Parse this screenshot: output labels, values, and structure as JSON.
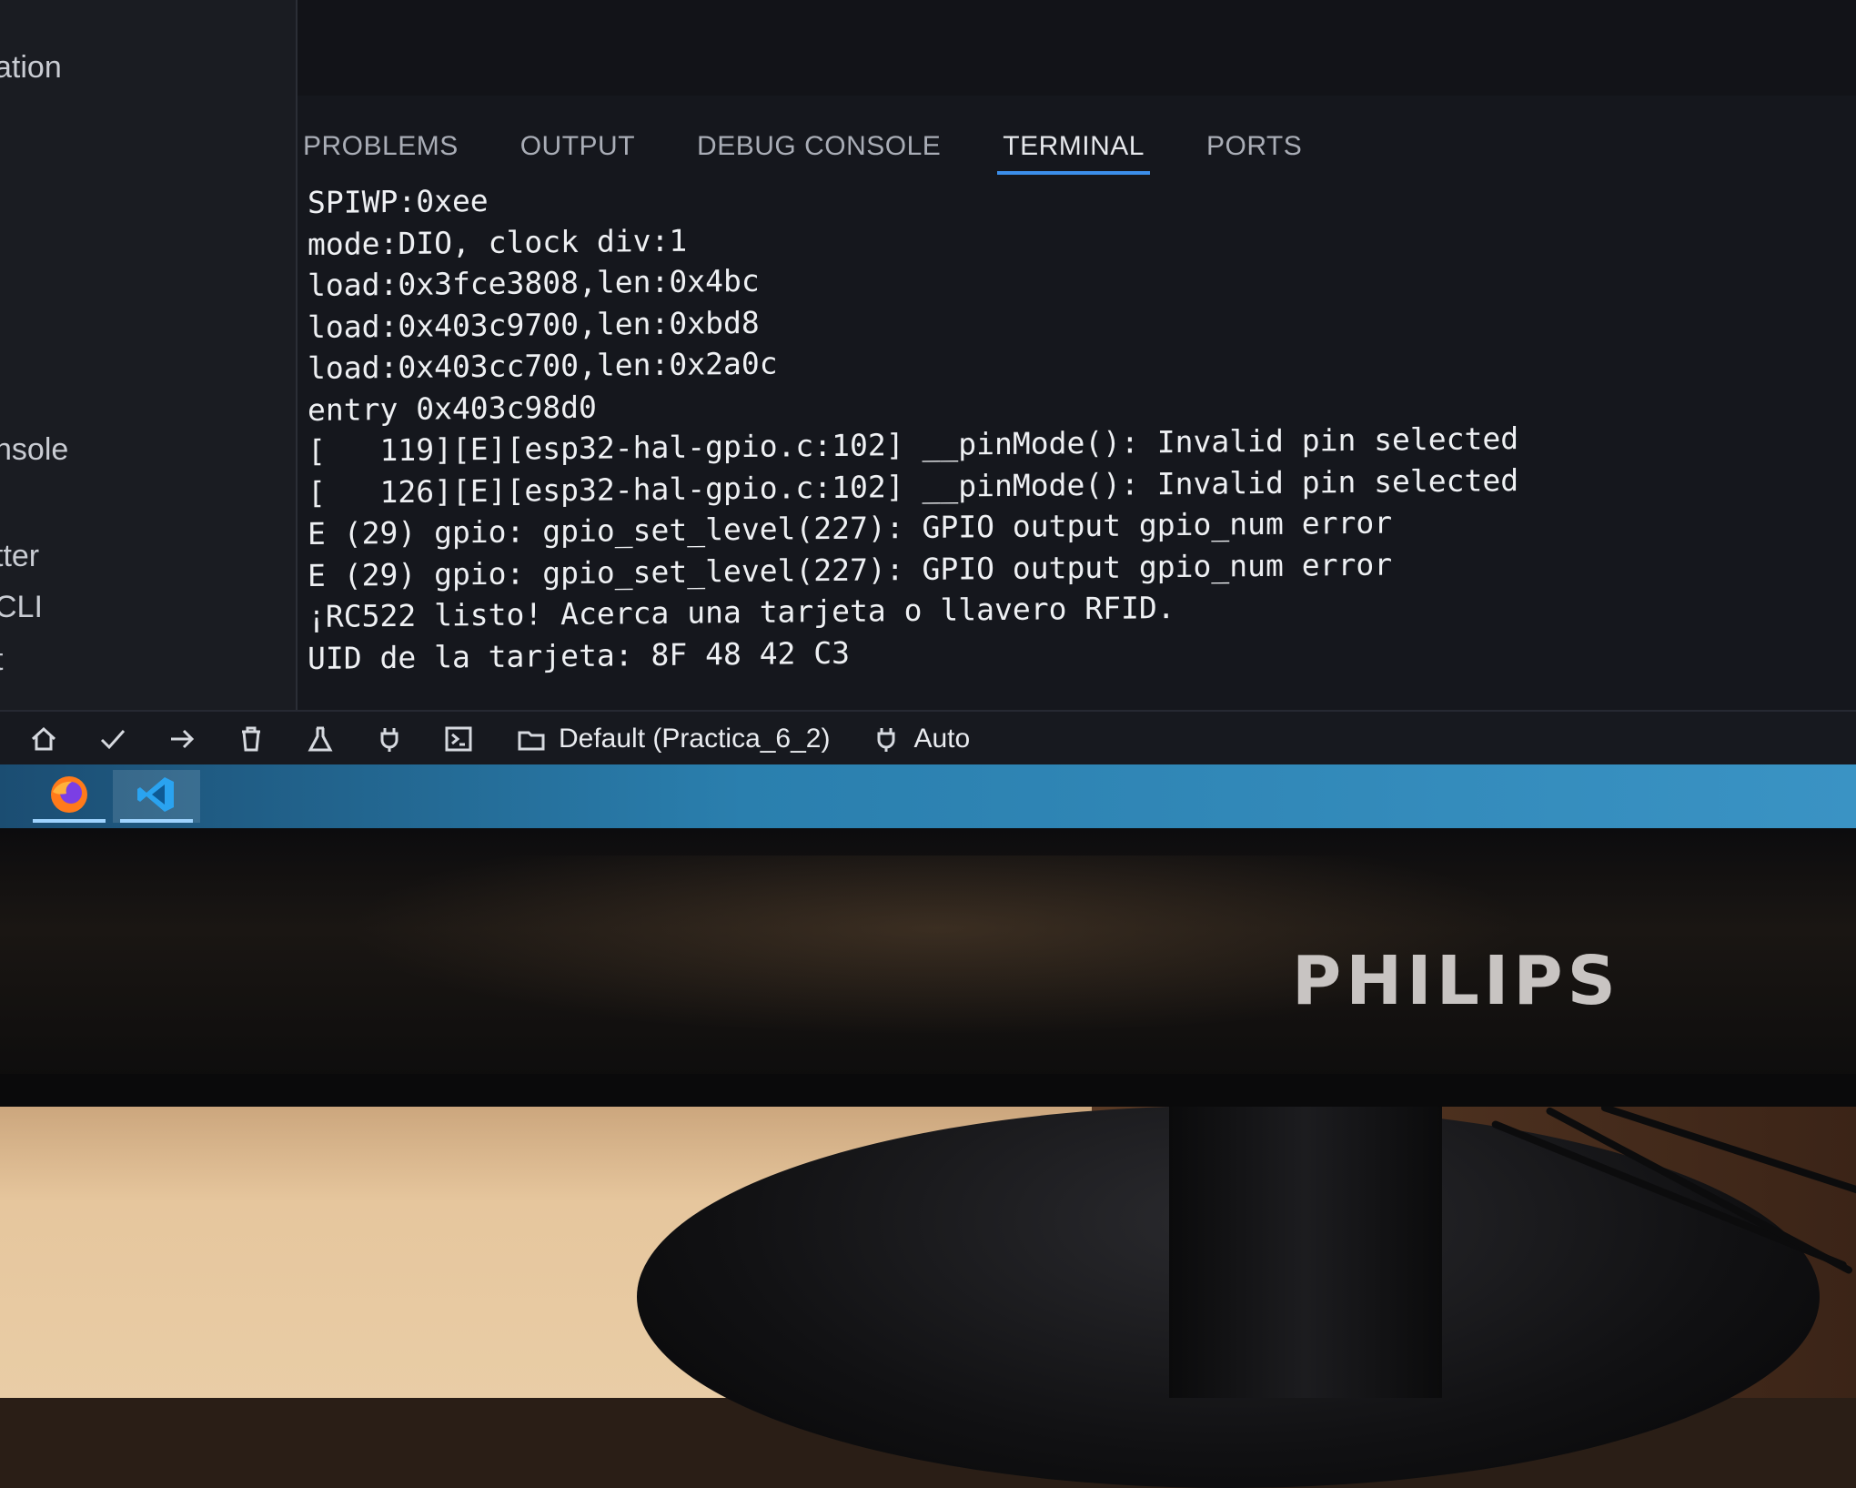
{
  "sidebar": {
    "items": [
      "ation",
      "nsole",
      "tter",
      "CLI",
      "t"
    ]
  },
  "panel_tabs": [
    "PROBLEMS",
    "OUTPUT",
    "DEBUG CONSOLE",
    "TERMINAL",
    "PORTS"
  ],
  "active_tab": "TERMINAL",
  "terminal": {
    "lines": [
      "SPIWP:0xee",
      "mode:DIO, clock div:1",
      "load:0x3fce3808,len:0x4bc",
      "load:0x403c9700,len:0xbd8",
      "load:0x403cc700,len:0x2a0c",
      "entry 0x403c98d0",
      "[   119][E][esp32-hal-gpio.c:102] __pinMode(): Invalid pin selected",
      "[   126][E][esp32-hal-gpio.c:102] __pinMode(): Invalid pin selected",
      "E (29) gpio: gpio_set_level(227): GPIO output gpio_num error",
      "E (29) gpio: gpio_set_level(227): GPIO output gpio_num error",
      "¡RC522 listo! Acerca una tarjeta o llavero RFID.",
      "UID de la tarjeta: 8F 48 42 C3"
    ]
  },
  "statusbar": {
    "icons": [
      "home-icon",
      "check-icon",
      "arrow-right-icon",
      "trash-icon",
      "flask-icon",
      "plug-icon",
      "terminal-icon"
    ],
    "env_label": "Default (Practica_6_2)",
    "port_label": "Auto"
  },
  "taskbar": {
    "apps": [
      "firefox-icon",
      "vscode-icon"
    ]
  },
  "monitor": {
    "brand": "PHILIPS"
  },
  "colors": {
    "tab_accent": "#3b8eea",
    "taskbar": "#2a7fae"
  }
}
